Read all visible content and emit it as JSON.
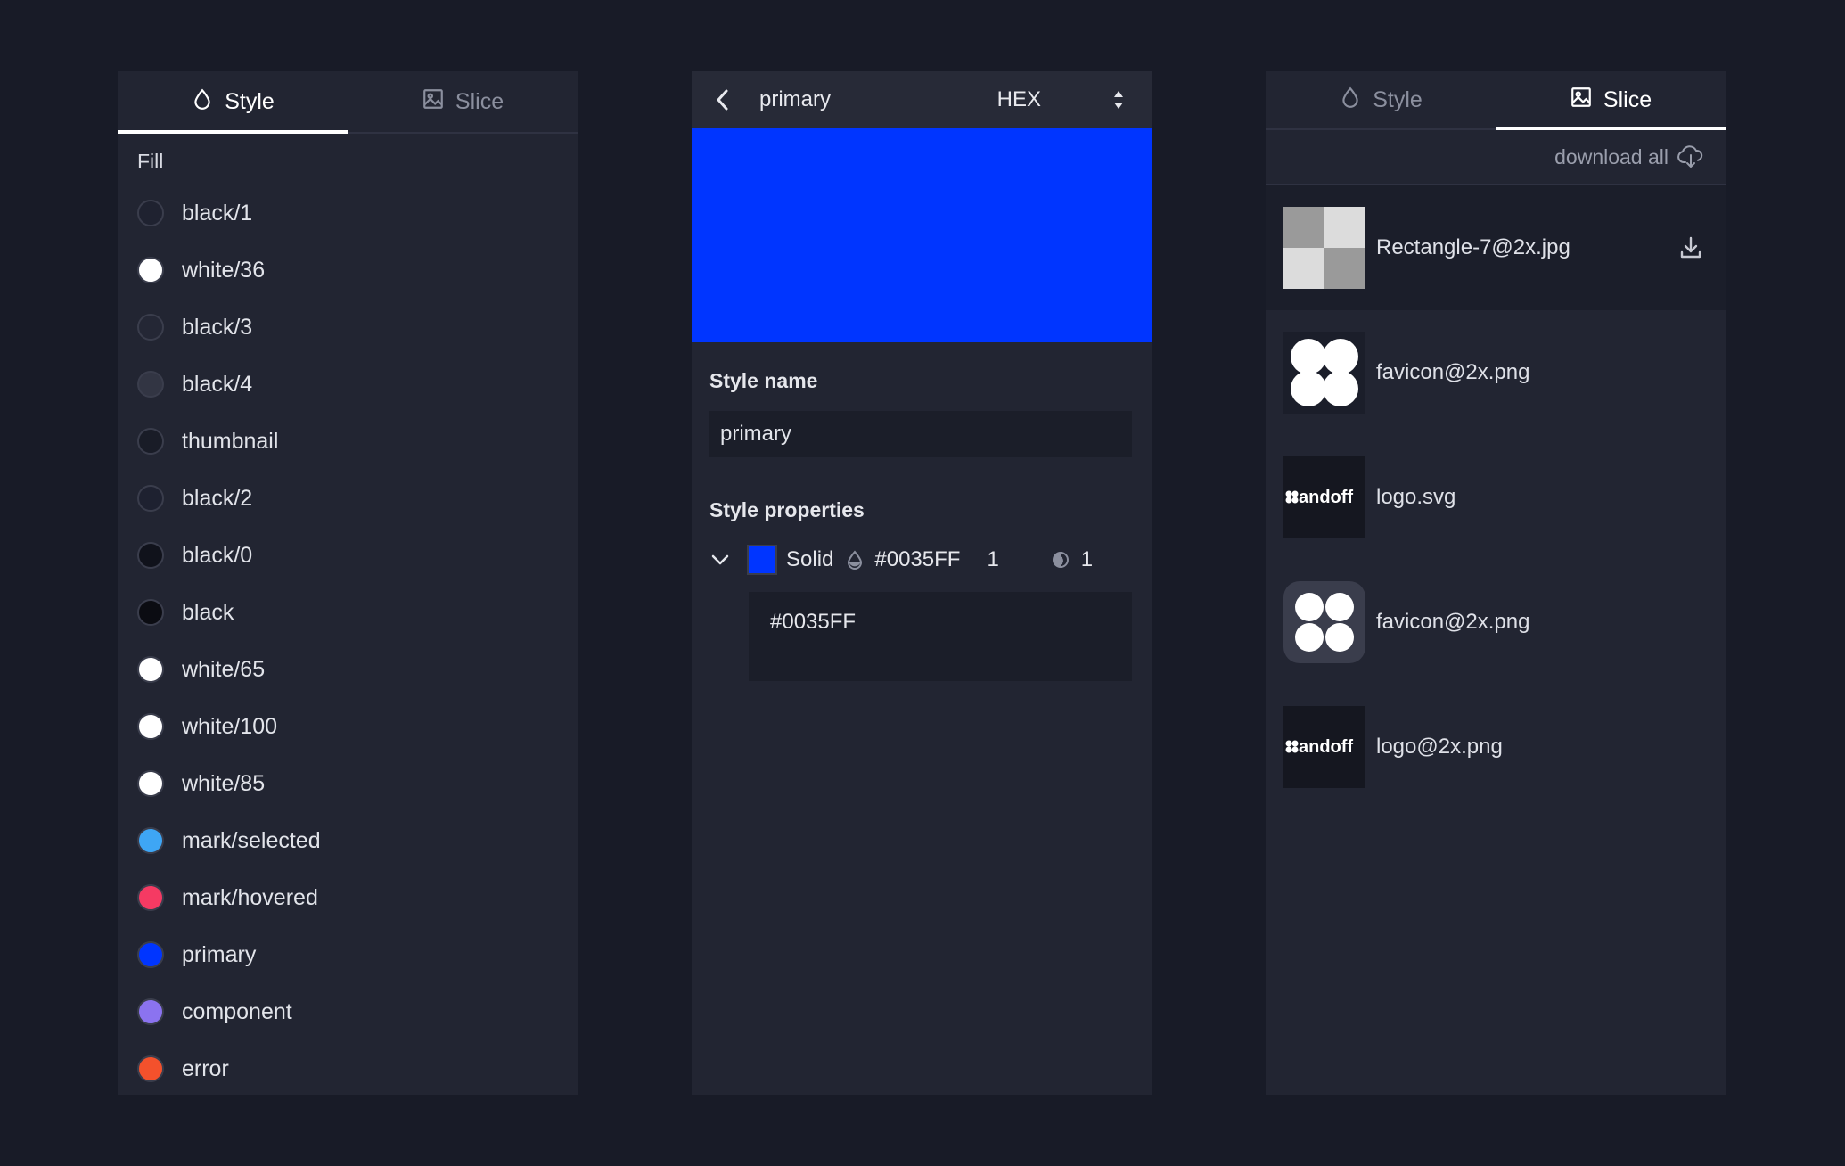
{
  "style_panel": {
    "tabs": [
      {
        "label": "Style"
      },
      {
        "label": "Slice"
      }
    ],
    "section_label": "Fill",
    "fills": [
      {
        "name": "black/1",
        "color": "#1f2230"
      },
      {
        "name": "white/36",
        "color": "#ffffff"
      },
      {
        "name": "black/3",
        "color": "#242735"
      },
      {
        "name": "black/4",
        "color": "#323543"
      },
      {
        "name": "thumbnail",
        "color": "#191c27"
      },
      {
        "name": "black/2",
        "color": "#1e2130"
      },
      {
        "name": "black/0",
        "color": "#10121b"
      },
      {
        "name": "black",
        "color": "#0b0c12"
      },
      {
        "name": "white/65",
        "color": "#ffffff"
      },
      {
        "name": "white/100",
        "color": "#ffffff"
      },
      {
        "name": "white/85",
        "color": "#ffffff"
      },
      {
        "name": "mark/selected",
        "color": "#3ea6f5"
      },
      {
        "name": "mark/hovered",
        "color": "#f53a63"
      },
      {
        "name": "primary",
        "color": "#0035ff"
      },
      {
        "name": "component",
        "color": "#8b73f0"
      },
      {
        "name": "error",
        "color": "#f4512c"
      }
    ]
  },
  "detail_panel": {
    "title": "primary",
    "format": "HEX",
    "preview_color": "#0035FF",
    "style_name_label": "Style name",
    "style_name_value": "primary",
    "properties_label": "Style properties",
    "property": {
      "type": "Solid",
      "hex": "#0035FF",
      "opacity": "1",
      "blend": "1"
    },
    "expanded_hex": "#0035FF"
  },
  "slice_panel": {
    "tabs": [
      {
        "label": "Style"
      },
      {
        "label": "Slice"
      }
    ],
    "download_all": "download all",
    "slices": [
      {
        "name": "Rectangle-7@2x.jpg",
        "thumb": "checker"
      },
      {
        "name": "favicon@2x.png",
        "thumb": "favicon-dark"
      },
      {
        "name": "logo.svg",
        "thumb": "logo",
        "logo_text": "andoff"
      },
      {
        "name": "favicon@2x.png",
        "thumb": "favicon-rounded"
      },
      {
        "name": "logo@2x.png",
        "thumb": "logo",
        "logo_text": "andoff"
      }
    ]
  }
}
